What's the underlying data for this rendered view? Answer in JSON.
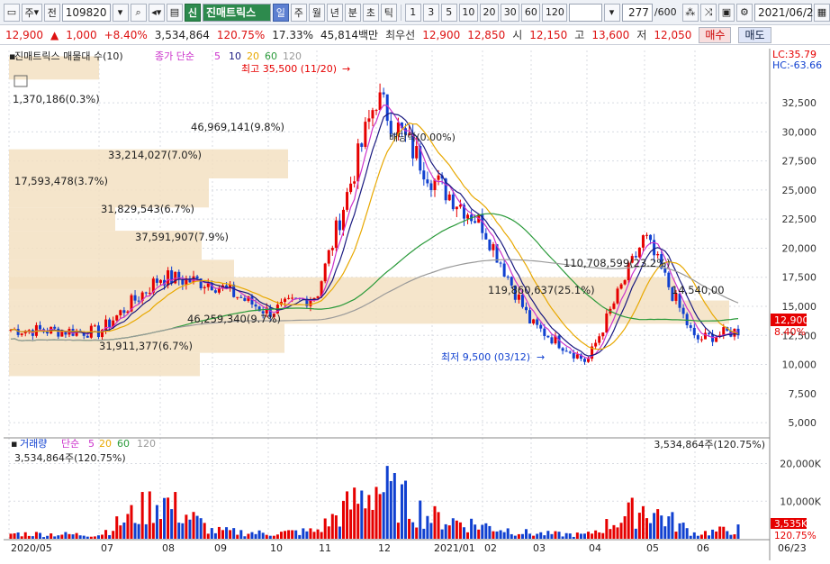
{
  "toolbar": {
    "market_ju": "주",
    "market_jeon": "전",
    "code": "109820",
    "badge_sin": "신",
    "stock_name": "진매트릭스",
    "periods": [
      "일",
      "주",
      "월",
      "년",
      "분",
      "초",
      "틱"
    ],
    "selected_period": "일",
    "intervals": [
      "1",
      "3",
      "5",
      "10",
      "20",
      "30",
      "60",
      "120"
    ],
    "count": "277",
    "count_max": "/600",
    "date": "2021/06/23"
  },
  "quote": {
    "price": "12,900",
    "change": "1,000",
    "change_pct": "+8.40%",
    "volume": "3,534,864",
    "volume_ratio": "120.75%",
    "turnover": "17.33%",
    "amount": "45,814백만",
    "best_bid_label": "최우선",
    "ask": "12,900",
    "bid": "12,850",
    "open_label": "시",
    "open": "12,150",
    "high_label": "고",
    "high": "13,600",
    "low_label": "저",
    "low": "12,050",
    "buy_label": "매수",
    "sell_label": "매도"
  },
  "chart": {
    "legend_title": "진매트릭스 매물대 수(10)",
    "ma_label": "종가 단순",
    "ma_periods": [
      "5",
      "10",
      "20",
      "60",
      "120"
    ],
    "lc_label": "LC:35.79",
    "hc_label": "HC:-63.66",
    "current_price_tag": "12,900",
    "current_pct_tag": "8.40%",
    "high_annotation": "최고 35,500 (11/20)",
    "low_annotation": "최저 9,500 (03/12)",
    "dividend_annotation": "배당락(0.00%)",
    "volume_profile_labels": [
      "1,370,186(0.3%)",
      "46,969,141(9.8%)",
      "33,214,027(7.0%)",
      "17,593,478(3.7%)",
      "31,829,543(6.7%)",
      "37,591,907(7.9%)",
      "110,708,599(23.2%)",
      "119,860,637(25.1%)",
      "14,540,00",
      "46,259,340(9.7%)",
      "31,911,377(6.7%)"
    ],
    "price_ticks": [
      "32,500",
      "30,000",
      "27,500",
      "25,000",
      "22,500",
      "20,000",
      "17,500",
      "15,000",
      "12,500",
      "10,000",
      "7,500",
      "5,000"
    ],
    "volume_legend": "거래량",
    "volume_ma_label": "단순",
    "volume_ma_periods": [
      "5",
      "20",
      "60",
      "120"
    ],
    "volume_top_left": "3,534,864주(120.75%)",
    "volume_top_right": "3,534,864주(120.75%)",
    "volume_ticks": [
      "20,000K",
      "10,000K"
    ],
    "volume_tag": "3,535K",
    "volume_pct_tag": "120.75%",
    "x_labels": [
      "2020/05",
      "07",
      "08",
      "09",
      "10",
      "11",
      "12",
      "2021/01",
      "02",
      "03",
      "04",
      "05",
      "06",
      "06/23"
    ]
  },
  "colors": {
    "up": "#e60000",
    "down": "#1040d0",
    "ma5": "#cc33cc",
    "ma10": "#1a1a80",
    "ma20": "#e8a800",
    "ma60": "#2a9a3a",
    "ma120": "#999999",
    "profile": "#f3e0c2"
  },
  "chart_data": {
    "type": "candlestick",
    "x": [
      "2020/05",
      "07",
      "08",
      "09",
      "10",
      "11",
      "12",
      "2021/01",
      "02",
      "03",
      "04",
      "05",
      "06",
      "06/23"
    ],
    "close_approx": [
      13000,
      12800,
      17500,
      17000,
      14500,
      16000,
      33000,
      26000,
      22000,
      13500,
      10200,
      21000,
      12100,
      12900
    ],
    "volume_approx_k": [
      2000,
      1500,
      15000,
      3000,
      2000,
      3000,
      20000,
      8000,
      5000,
      2000,
      1500,
      12000,
      2000,
      3535
    ],
    "ylim": [
      4000,
      37000
    ],
    "vol_ylim": [
      0,
      23000
    ]
  }
}
